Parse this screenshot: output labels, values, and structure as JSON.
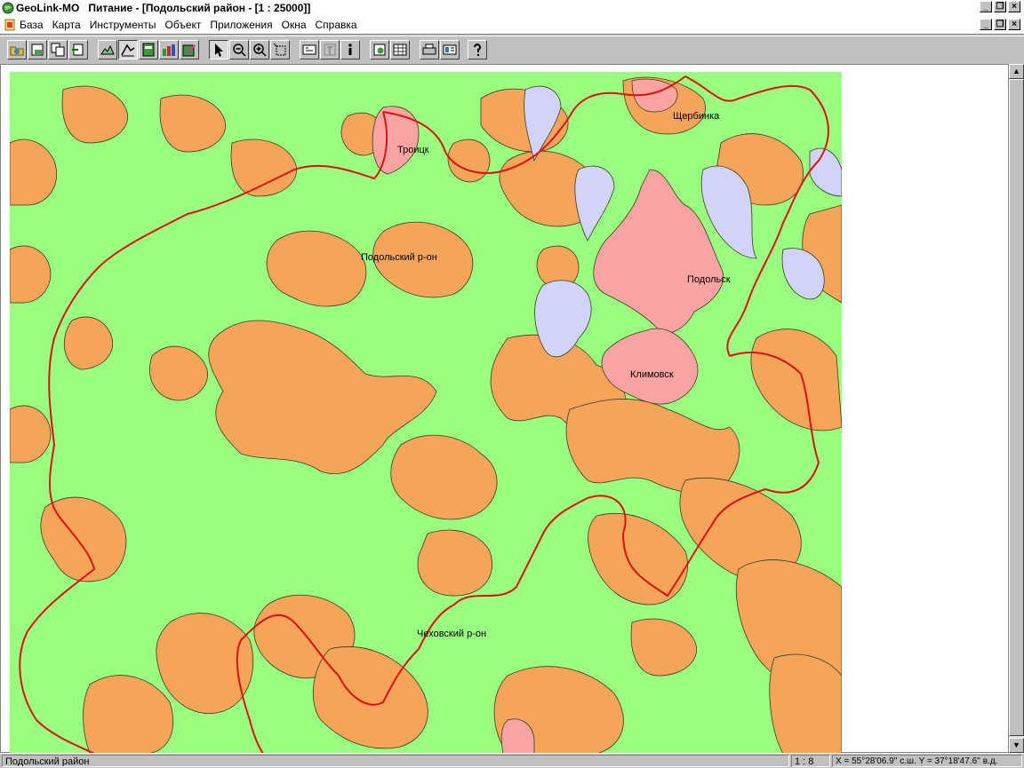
{
  "window": {
    "title": "GeoLink-MO   Питание - [Подольский район - [1 : 25000]]"
  },
  "menu": {
    "items": [
      "База",
      "Карта",
      "Инструменты",
      "Объект",
      "Приложения",
      "Окна",
      "Справка"
    ]
  },
  "toolbar": {
    "icons": [
      "open-icon",
      "save-icon",
      "copy-icon",
      "export-icon",
      "layers-icon",
      "legend-icon",
      "table-icon",
      "chart-icon",
      "edit-icon",
      "pointer-icon",
      "zoom-out-icon",
      "zoom-in-icon",
      "zoom-box-icon",
      "info-box-icon",
      "text-icon",
      "info-icon",
      "add-layer-icon",
      "grid-icon",
      "print-icon",
      "report-icon",
      "help-icon"
    ]
  },
  "map": {
    "labels": {
      "troitsk": "Троицк",
      "shcherbinka": "Щербинка",
      "podolsk_district": "Подольский р-он",
      "podolsk": "Подольск",
      "klimovsk": "Климовск",
      "chekhov_district": "Чеховский р-он"
    },
    "colors": {
      "forest": "#99ff80",
      "open_land": "#f5a55a",
      "urban": "#f9a3a3",
      "water": "#d0d4f8",
      "boundary": "#e01010"
    }
  },
  "status": {
    "layer": "Подольский район",
    "scale": "1 : 8",
    "coords": "X = 55°28'06.9'' с.ш.  Y = 37°18'47.6'' в.д."
  }
}
